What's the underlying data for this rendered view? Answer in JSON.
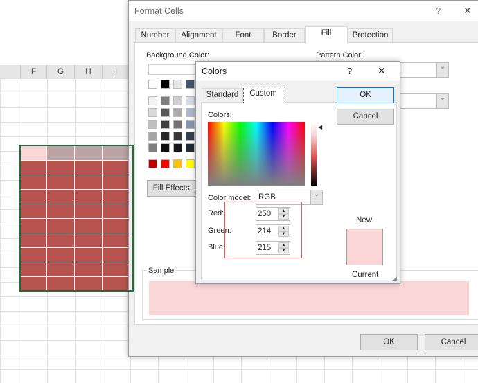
{
  "sheet": {
    "columns": [
      "F",
      "G",
      "H",
      "I"
    ],
    "fill_color": "#b85450",
    "first_row_colors": [
      "#fad6d7",
      "#bca4a5",
      "#bca4a5",
      "#bca4a5"
    ]
  },
  "format_cells": {
    "title": "Format Cells",
    "help": "?",
    "close": "✕",
    "tabs": [
      "Number",
      "Alignment",
      "Font",
      "Border",
      "Fill",
      "Protection"
    ],
    "active_tab": "Fill",
    "background_color_label": "Background Color:",
    "pattern_color_label": "Pattern Color:",
    "fill_effects": "Fill Effects...",
    "sample_label": "Sample",
    "sample_color": "#fad6d7",
    "ok": "OK",
    "cancel": "Cancel",
    "palette": {
      "top": [
        "#ffffff",
        "#000000",
        "#e7e6e6",
        "#44546a"
      ],
      "rows": [
        [
          "#f2f2f2",
          "#7f7f7f",
          "#d0cece",
          "#d6dce4"
        ],
        [
          "#d9d9d9",
          "#595959",
          "#aeaaaa",
          "#adb9ca"
        ],
        [
          "#bfbfbf",
          "#3f3f3f",
          "#767171",
          "#8497b0"
        ],
        [
          "#a6a6a6",
          "#262626",
          "#3a3838",
          "#333f4f"
        ],
        [
          "#7f7f7f",
          "#0c0c0c",
          "#171616",
          "#222a35"
        ]
      ],
      "standard": [
        "#c00000",
        "#ff0000",
        "#ffc000",
        "#ffff00"
      ]
    }
  },
  "colors": {
    "title": "Colors",
    "help": "?",
    "close": "✕",
    "tabs": [
      "Standard",
      "Custom"
    ],
    "active_tab": "Custom",
    "colors_label": "Colors:",
    "color_model_label": "Color model:",
    "color_model": "RGB",
    "red_label": "Red:",
    "red": "250",
    "green_label": "Green:",
    "green": "214",
    "blue_label": "Blue:",
    "blue": "215",
    "ok": "OK",
    "cancel": "Cancel",
    "new_label": "New",
    "current_label": "Current",
    "new_color": "#fad6d7",
    "highlight_color": "#e8595b"
  }
}
